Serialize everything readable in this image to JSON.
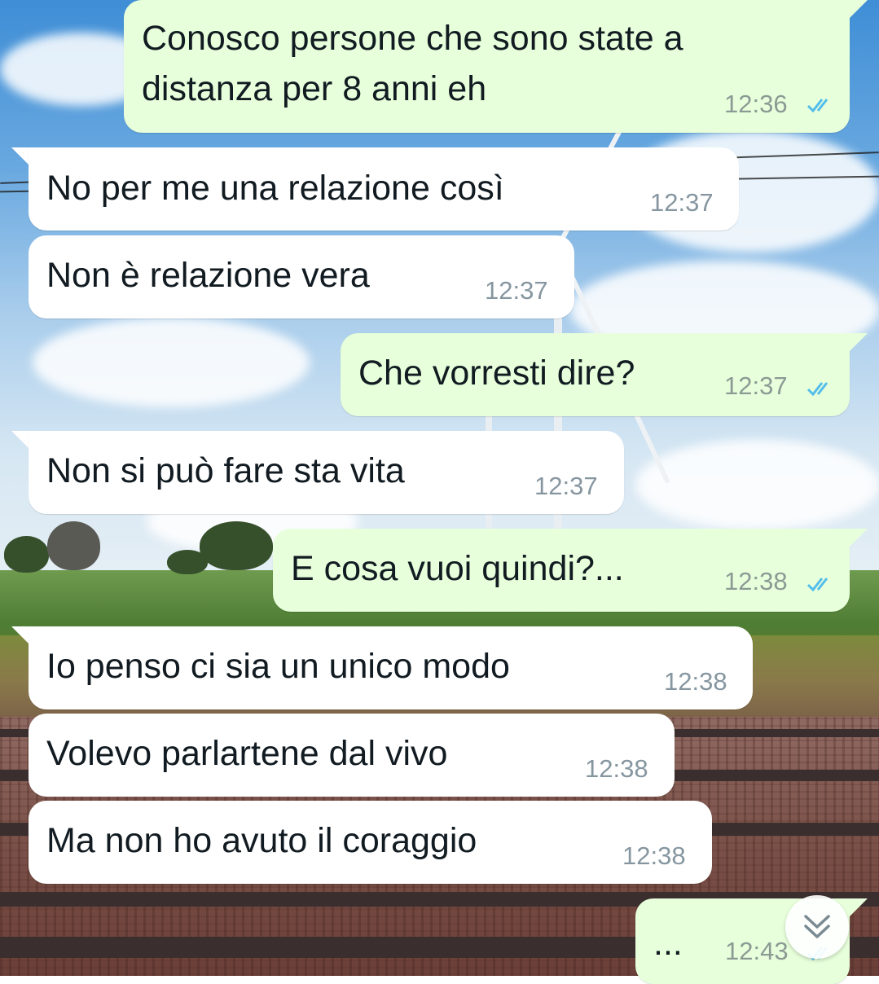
{
  "messages": [
    {
      "text": "Conosco persone che sono state a\ndistanza per 8 anni eh",
      "time": "12:36",
      "read": true
    },
    {
      "text": "No per me una relazione così",
      "time": "12:37"
    },
    {
      "text": "Non è relazione vera",
      "time": "12:37"
    },
    {
      "text": "Che vorresti dire?",
      "time": "12:37",
      "read": true
    },
    {
      "text": "Non si può fare sta vita",
      "time": "12:37"
    },
    {
      "text": "E cosa vuoi quindi?...",
      "time": "12:38",
      "read": true
    },
    {
      "text": "Io penso ci sia un unico modo",
      "time": "12:38"
    },
    {
      "text": "Volevo parlartene dal vivo",
      "time": "12:38"
    },
    {
      "text": "Ma non ho avuto il coraggio",
      "time": "12:38"
    },
    {
      "text": "...",
      "time": "12:43",
      "read": true
    }
  ],
  "colors": {
    "incoming_bubble": "#ffffff",
    "outgoing_bubble": "#e7ffdb",
    "read_ticks": "#53bdeb",
    "timestamp": "#8696a0"
  },
  "icons": {
    "read_receipt": "double-check-icon",
    "scroll_down": "double-chevron-down-icon"
  }
}
